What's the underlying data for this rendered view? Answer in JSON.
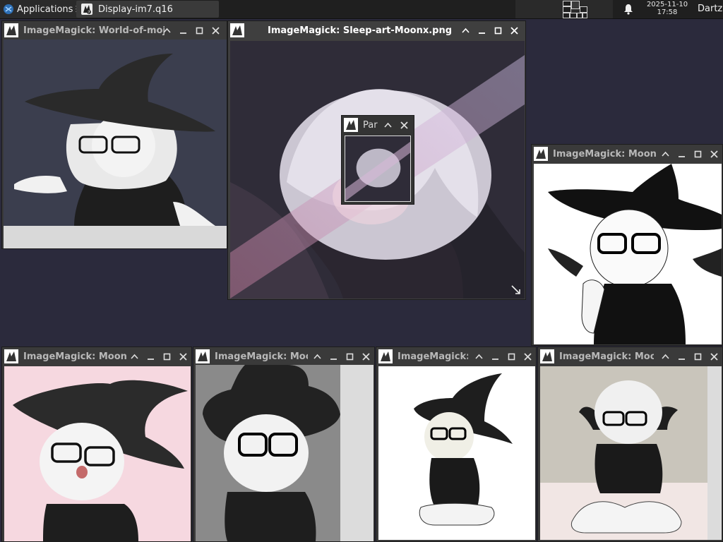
{
  "panel": {
    "applications_label": "Applications",
    "separator": "☰",
    "task_label": "Display-im7.q16",
    "clock_date": "2025-11-10",
    "clock_time": "17:58",
    "user": "Dartz"
  },
  "windows": {
    "w1": {
      "title": "ImageMagick: World-of-moja"
    },
    "w2": {
      "title": "ImageMagick: Sleep-art-Moonx.png"
    },
    "w3": {
      "title": "Par"
    },
    "w4": {
      "title": "ImageMagick: Moonx"
    },
    "w5": {
      "title": "ImageMagick: Moonx"
    },
    "w6": {
      "title": "ImageMagick: Moon"
    },
    "w7": {
      "title": "ImageMagick: I"
    },
    "w8": {
      "title": "ImageMagick: Moon"
    }
  },
  "icons": {
    "menu": "xfce-logo-icon",
    "task": "imagemagick-icon",
    "pager": "workspace-pager-icon",
    "bell": "bell-icon",
    "shade": "chevron-up-icon",
    "minimize": "minimize-icon",
    "maximize": "maximize-icon",
    "close": "close-icon",
    "resize": "resize-corner-icon"
  },
  "colors": {
    "desktop": "#2b2a3c",
    "panel": "#1f1f1f",
    "window_frame": "#3a3a3a"
  }
}
